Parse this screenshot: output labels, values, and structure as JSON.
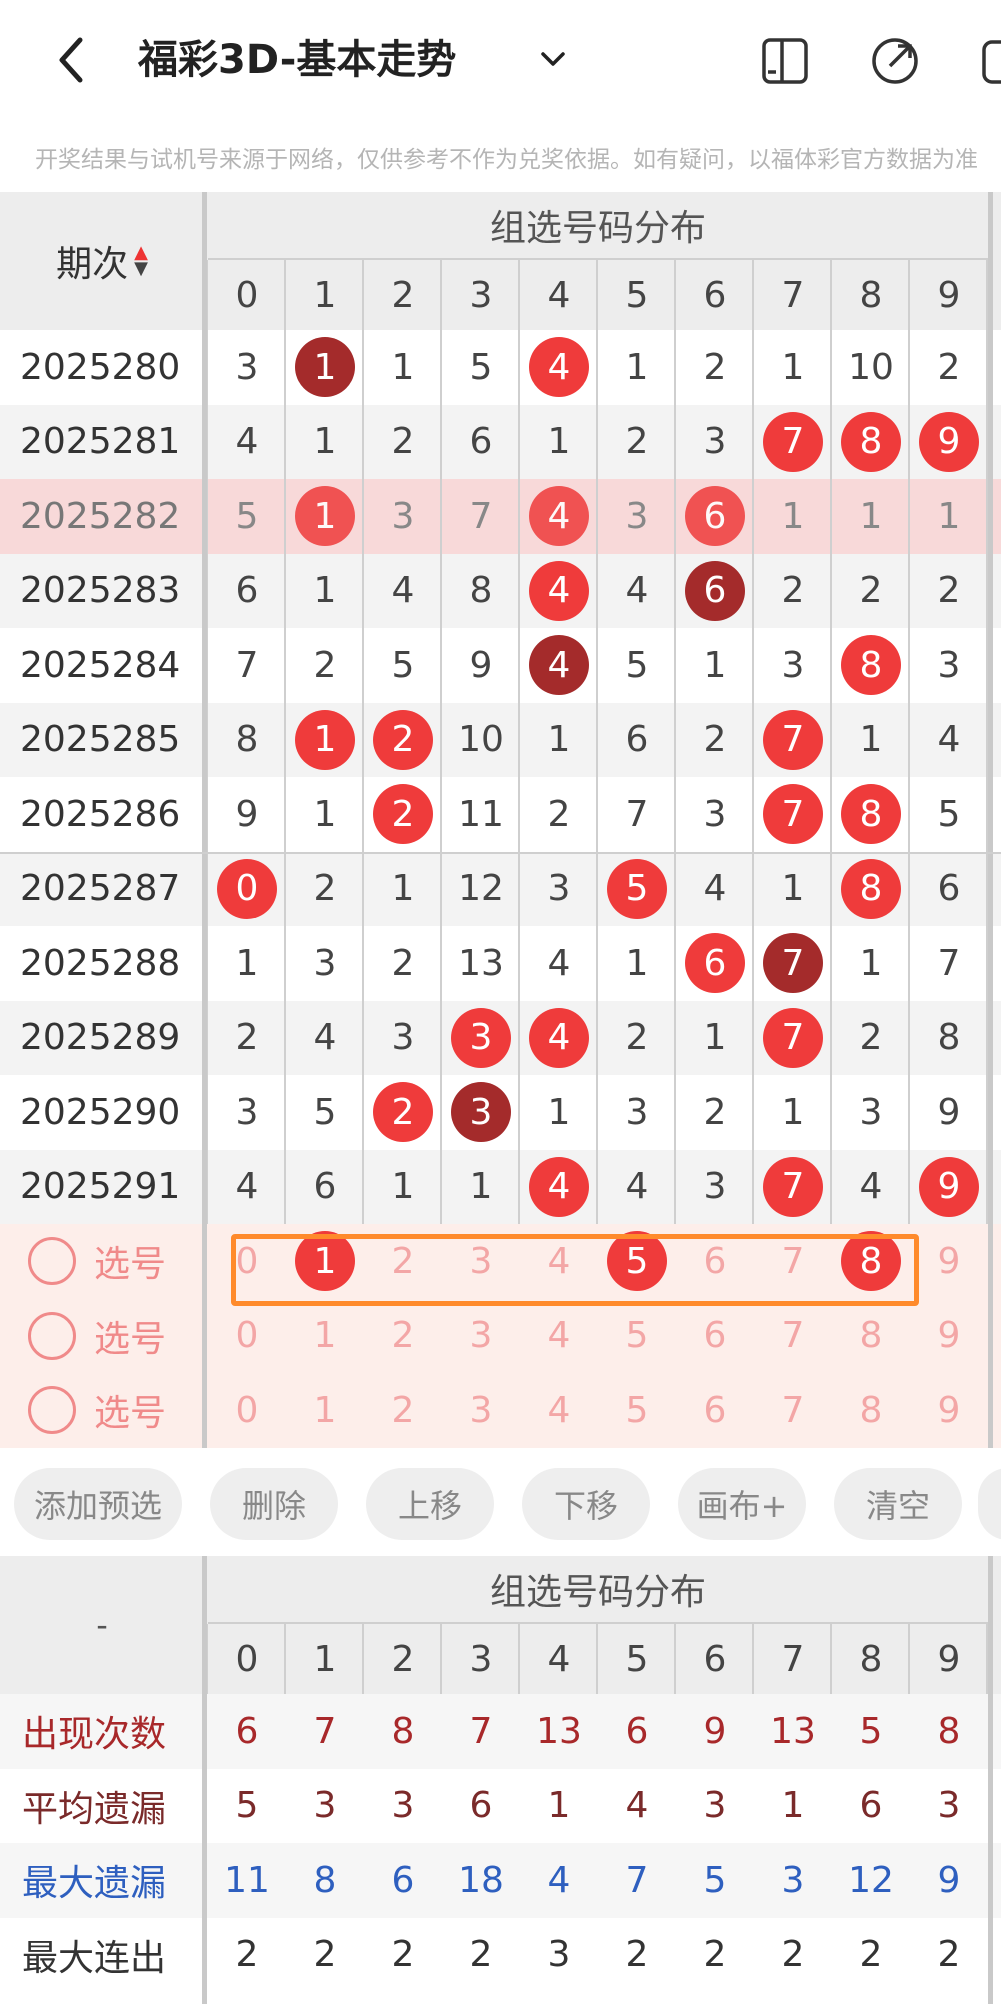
{
  "header": {
    "title": "福彩3D-基本走势",
    "back_icon": "chevron-left-icon",
    "caret_icon": "chevron-down-icon",
    "icons": [
      "layout-icon",
      "share-icon",
      "more-icon"
    ]
  },
  "notice": "开奖结果与试机号来源于网络，仅供参考不作为兑奖依据。如有疑问，以福体彩官方数据为准",
  "table1": {
    "period_header": "期次",
    "section_header": "组选号码分布",
    "digits": [
      "0",
      "1",
      "2",
      "3",
      "4",
      "5",
      "6",
      "7",
      "8",
      "9"
    ],
    "rows": [
      {
        "period": "2025280",
        "cells": [
          "3",
          "1",
          "1",
          "5",
          "4",
          "1",
          "2",
          "1",
          "10",
          "2"
        ],
        "balls": {
          "1": "dark",
          "4": "red"
        }
      },
      {
        "period": "2025281",
        "cells": [
          "4",
          "1",
          "2",
          "6",
          "1",
          "2",
          "3",
          "7",
          "8",
          "9"
        ],
        "balls": {
          "7": "red",
          "8": "red",
          "9": "red"
        }
      },
      {
        "period": "2025282",
        "cells": [
          "5",
          "1",
          "3",
          "7",
          "4",
          "3",
          "6",
          "1",
          "1",
          "1"
        ],
        "balls": {
          "1": "red",
          "4": "red",
          "6": "red"
        },
        "highlight": true
      },
      {
        "period": "2025283",
        "cells": [
          "6",
          "1",
          "4",
          "8",
          "4",
          "4",
          "6",
          "2",
          "2",
          "2"
        ],
        "balls": {
          "4": "red",
          "6": "dark"
        }
      },
      {
        "period": "2025284",
        "cells": [
          "7",
          "2",
          "5",
          "9",
          "4",
          "5",
          "1",
          "3",
          "8",
          "3"
        ],
        "balls": {
          "4": "dark",
          "8": "red"
        }
      },
      {
        "period": "2025285",
        "cells": [
          "8",
          "1",
          "2",
          "10",
          "1",
          "6",
          "2",
          "7",
          "1",
          "4"
        ],
        "balls": {
          "1": "red",
          "2": "red",
          "7": "red"
        }
      },
      {
        "period": "2025286",
        "cells": [
          "9",
          "1",
          "2",
          "11",
          "2",
          "7",
          "3",
          "7",
          "8",
          "5"
        ],
        "balls": {
          "2": "red",
          "7": "red",
          "8": "red"
        }
      },
      {
        "period": "2025287",
        "cells": [
          "0",
          "2",
          "1",
          "12",
          "3",
          "5",
          "4",
          "1",
          "8",
          "6"
        ],
        "balls": {
          "0": "red",
          "5": "red",
          "8": "red"
        }
      },
      {
        "period": "2025288",
        "cells": [
          "1",
          "3",
          "2",
          "13",
          "4",
          "1",
          "6",
          "7",
          "1",
          "7"
        ],
        "balls": {
          "6": "red",
          "7": "dark"
        }
      },
      {
        "period": "2025289",
        "cells": [
          "2",
          "4",
          "3",
          "3",
          "4",
          "2",
          "1",
          "7",
          "2",
          "8"
        ],
        "balls": {
          "3": "red",
          "4": "red",
          "7": "red"
        }
      },
      {
        "period": "2025290",
        "cells": [
          "3",
          "5",
          "2",
          "3",
          "1",
          "3",
          "2",
          "1",
          "3",
          "9"
        ],
        "balls": {
          "2": "red",
          "3": "dark"
        }
      },
      {
        "period": "2025291",
        "cells": [
          "4",
          "6",
          "1",
          "1",
          "4",
          "4",
          "3",
          "7",
          "4",
          "9"
        ],
        "balls": {
          "4": "red",
          "7": "red",
          "9": "red"
        }
      }
    ],
    "pick_rows": [
      {
        "label": "选号",
        "selected": [
          "1",
          "5",
          "8"
        ]
      },
      {
        "label": "选号",
        "selected": []
      },
      {
        "label": "选号",
        "selected": []
      }
    ]
  },
  "buttons": [
    "添加预选",
    "删除",
    "上移",
    "下移",
    "画布+",
    "清空"
  ],
  "table2": {
    "corner": "-",
    "section_header": "组选号码分布",
    "digits": [
      "0",
      "1",
      "2",
      "3",
      "4",
      "5",
      "6",
      "7",
      "8",
      "9"
    ],
    "stats": [
      {
        "label": "出现次数",
        "color": "#a8282a",
        "values": [
          "6",
          "7",
          "8",
          "7",
          "13",
          "6",
          "9",
          "13",
          "5",
          "8"
        ]
      },
      {
        "label": "平均遗漏",
        "color": "#7a2a2a",
        "values": [
          "5",
          "3",
          "3",
          "6",
          "1",
          "4",
          "3",
          "1",
          "6",
          "3"
        ]
      },
      {
        "label": "最大遗漏",
        "color": "#2e5fbf",
        "values": [
          "11",
          "8",
          "6",
          "18",
          "4",
          "7",
          "5",
          "3",
          "12",
          "9"
        ]
      },
      {
        "label": "最大连出",
        "color": "#333333",
        "values": [
          "2",
          "2",
          "2",
          "2",
          "3",
          "2",
          "2",
          "2",
          "2",
          "2"
        ]
      }
    ]
  },
  "colors": {
    "red_ball": "#ef3b3b",
    "dark_ball": "#a42b2b",
    "pick_bg": "#fdeeea",
    "highlight_row": "#f8d9d9",
    "accent_box": "#ff8a2b"
  }
}
